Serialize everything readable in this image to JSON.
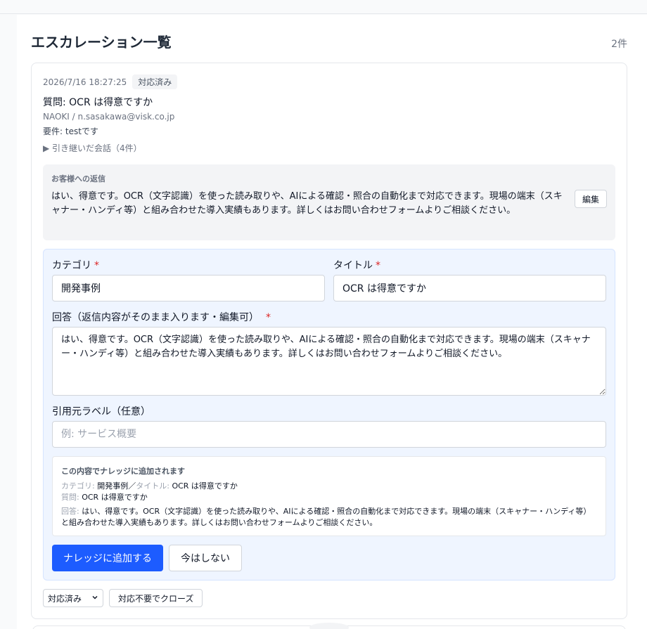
{
  "page": {
    "title": "エスカレーション一覧",
    "count": "2件"
  },
  "item": {
    "timestamp": "2026/7/16 18:27:25",
    "status_badge": "対応済み",
    "question": "質問: OCR は得意ですか",
    "user": "NAOKI / n.sasakawa@visk.co.jp",
    "requirement": "要件: testです",
    "conversation_toggle": "▶ 引き継いだ会話（4件）",
    "reply": {
      "label": "お客様への返信",
      "text": "はい、得意です。OCR（文字認識）を使った読み取りや、AIによる確認・照合の自動化まで対応できます。現場の端末（スキャナー・ハンディ等）と組み合わせた導入実績もあります。詳しくはお問い合わせフォームよりご相談ください。",
      "edit_label": "編集"
    },
    "form": {
      "category_label": "カテゴリ",
      "category_value": "開発事例",
      "title_label": "タイトル",
      "title_value": "OCR は得意ですか",
      "answer_label": "回答（返信内容がそのまま入ります・編集可）",
      "answer_value": "はい、得意です。OCR（文字認識）を使った読み取りや、AIによる確認・照合の自動化まで対応できます。現場の端末（スキャナー・ハンディ等）と組み合わせた導入実績もあります。詳しくはお問い合わせフォームよりご相談ください。",
      "source_label": "引用元ラベル（任意）",
      "source_placeholder": "例: サービス概要",
      "required_mark": "*",
      "preview": {
        "title": "この内容でナレッジに追加されます",
        "category_key": "カテゴリ:",
        "category_value": "開発事例",
        "separator": "／",
        "title_key": "タイトル:",
        "title_value": "OCR は得意ですか",
        "question_key": "質問:",
        "question_value": "OCR は得意ですか",
        "answer_key": "回答:",
        "answer_value": "はい、得意です。OCR（文字認識）を使った読み取りや、AIによる確認・照合の自動化まで対応できます。現場の端末（スキャナー・ハンディ等）と組み合わせた導入実績もあります。詳しくはお問い合わせフォームよりご相談ください。"
      },
      "add_button": "ナレッジに追加する",
      "skip_button": "今はしない"
    },
    "status_select": "対応済み",
    "close_button": "対応不要でクローズ"
  }
}
